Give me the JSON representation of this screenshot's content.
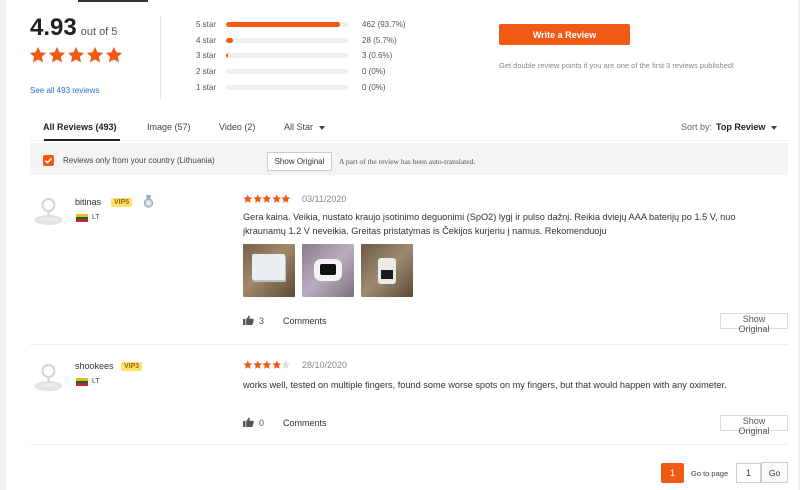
{
  "colors": {
    "accent": "#f05a14",
    "vip_bg": "#ffe16b",
    "link": "#2e6fd3"
  },
  "summary": {
    "score": "4.93",
    "out_of": "out of 5",
    "stars_filled": 5,
    "see_all": "See all 493 reviews",
    "histogram": [
      {
        "label": "5 star",
        "count": "462 (93.7%)",
        "fraction": 0.937
      },
      {
        "label": "4 star",
        "count": "28 (5.7%)",
        "fraction": 0.057
      },
      {
        "label": "3 star",
        "count": "3 (0.6%)",
        "fraction": 0.006
      },
      {
        "label": "2 star",
        "count": "0 (0%)",
        "fraction": 0
      },
      {
        "label": "1 star",
        "count": "0 (0%)",
        "fraction": 0
      }
    ],
    "write_review": "Write a Review",
    "write_note": "Get double review points if you are one of the first 3 reviews published!"
  },
  "tabs": {
    "all_reviews": "All Reviews (493)",
    "image": "Image (57)",
    "video": "Video (2)",
    "all_star": "All Star",
    "sort_label": "Sort by:",
    "sort_value": "Top Review"
  },
  "filter": {
    "checkbox_checked": true,
    "country_label": "Reviews only from your country (Lithuania)",
    "show_original": "Show Original",
    "auto_translated": "A part of the review has been auto-translated."
  },
  "reviews": [
    {
      "username": "bitinas",
      "vip": "VIP5",
      "country": "LT",
      "stars": 5,
      "date": "03/11/2020",
      "text": "Gera kaina. Veikia, nustato kraujo įsotinimo deguonimi (SpO2) lygį ir pulso dažnį. Reikia dviejų AAA baterijų po 1.5 V, nuo įkraunamų 1.2 V neveikia. Greitas pristatymas is Čekijos kurjeriu į namus. Rekomenduoju",
      "likes": "3",
      "comments": "Comments",
      "show_original": "Show Original"
    },
    {
      "username": "shookees",
      "vip": "VIP3",
      "country": "LT",
      "stars": 4,
      "date": "28/10/2020",
      "text": "works well, tested on multiple fingers, found some worse spots on my fingers, but that would happen with any oximeter.",
      "likes": "0",
      "comments": "Comments",
      "show_original": "Show Original"
    }
  ],
  "pagination": {
    "current_page": "1",
    "goto_label": "Go to page",
    "goto_value": "1",
    "go": "Go"
  }
}
